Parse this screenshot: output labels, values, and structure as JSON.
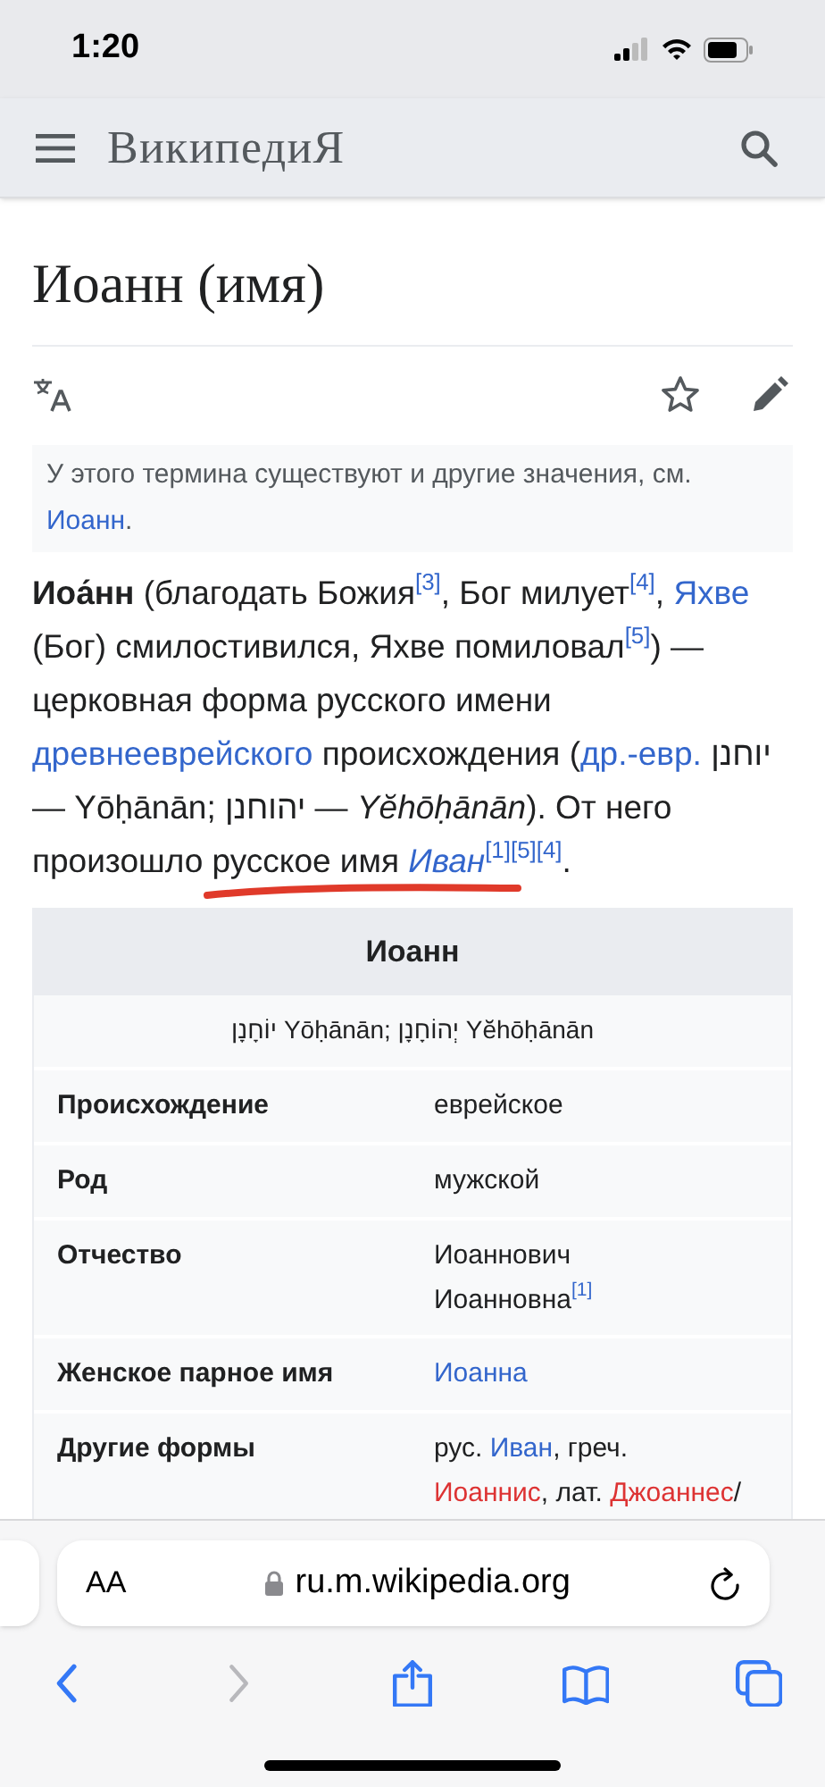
{
  "status_bar": {
    "time": "1:20"
  },
  "header": {
    "logo": "ВикипедиЯ"
  },
  "page": {
    "title": "Иоанн (имя)"
  },
  "hatnote": [
    {
      "kind": "text",
      "text": "У этого термина существуют и другие значения, см. "
    },
    {
      "kind": "link",
      "text": "Иоанн"
    },
    {
      "kind": "text",
      "text": "."
    }
  ],
  "intro": [
    {
      "kind": "bold",
      "text": "Иоа́нн"
    },
    {
      "kind": "text",
      "text": " (благодать Божия"
    },
    {
      "kind": "ref",
      "text": "[3]"
    },
    {
      "kind": "text",
      "text": ", Бог милует"
    },
    {
      "kind": "ref",
      "text": "[4]"
    },
    {
      "kind": "text",
      "text": ", "
    },
    {
      "kind": "link",
      "text": "Яхве"
    },
    {
      "kind": "text",
      "text": " (Бог) смилостивился, Яхве помиловал"
    },
    {
      "kind": "ref",
      "text": "[5]"
    },
    {
      "kind": "text",
      "text": ") — церковная форма русского имени "
    },
    {
      "kind": "link",
      "text": "древнееврейского"
    },
    {
      "kind": "text",
      "text": " происхождения ("
    },
    {
      "kind": "link",
      "text": "др.-евр."
    },
    {
      "kind": "text",
      "text": " יוחנן — Yōḥānān; יהוחנן — "
    },
    {
      "kind": "italic",
      "text": "Yĕhōḥānān"
    },
    {
      "kind": "text",
      "text": "). От него произошло русское имя "
    },
    {
      "kind": "italic_link",
      "text": "Иван"
    },
    {
      "kind": "ref",
      "text": "[1]"
    },
    {
      "kind": "ref",
      "text": "[5]"
    },
    {
      "kind": "ref",
      "text": "[4]"
    },
    {
      "kind": "text",
      "text": "."
    }
  ],
  "infobox": {
    "title": "Иоанн",
    "subtitle": "יוֹחָנָן Yōḥānān; יְהוֹחָנָן Yĕhōḥānān",
    "rows": [
      {
        "label": "Происхождение",
        "lines": [
          [
            {
              "kind": "text",
              "text": "еврейское"
            }
          ]
        ]
      },
      {
        "label": "Род",
        "lines": [
          [
            {
              "kind": "text",
              "text": "мужской"
            }
          ]
        ]
      },
      {
        "label": "Отчество",
        "lines": [
          [
            {
              "kind": "text",
              "text": "Иоаннович"
            }
          ],
          [
            {
              "kind": "text",
              "text": "Иоанновна"
            },
            {
              "kind": "ref",
              "text": "[1]"
            }
          ]
        ]
      },
      {
        "label": "Женское парное имя",
        "lines": [
          [
            {
              "kind": "link",
              "text": "Иоанна"
            }
          ]
        ]
      },
      {
        "label": "Другие формы",
        "lines": [
          [
            {
              "kind": "text",
              "text": "рус. "
            },
            {
              "kind": "link",
              "text": "Иван"
            },
            {
              "kind": "text",
              "text": ", греч."
            }
          ],
          [
            {
              "kind": "redlink",
              "text": "Иоаннис"
            },
            {
              "kind": "text",
              "text": ", лат. "
            },
            {
              "kind": "redlink",
              "text": "Джоаннес"
            },
            {
              "kind": "text",
              "text": "/"
            }
          ]
        ]
      }
    ]
  },
  "address_bar": {
    "text_size_button": "AA",
    "url": "ru.m.wikipedia.org"
  },
  "toolbar": [
    {
      "kind": "back",
      "disabled": false
    },
    {
      "kind": "forward",
      "disabled": true
    },
    {
      "kind": "share",
      "disabled": false
    },
    {
      "kind": "bookmarks",
      "disabled": false
    },
    {
      "kind": "tabs",
      "disabled": false
    }
  ]
}
